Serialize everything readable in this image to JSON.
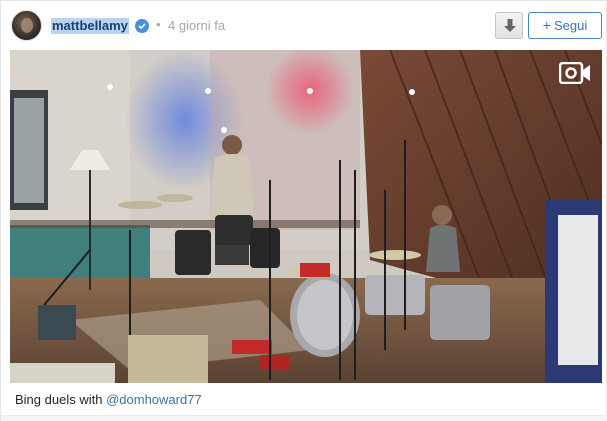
{
  "post": {
    "username": "mattbellamy",
    "separator": "•",
    "timestamp": "4 giorni fa",
    "follow_label": "Segui",
    "follow_plus": "+",
    "caption_text": "Bing duels with",
    "caption_mention": "@domhoward77"
  },
  "icons": {
    "verified": "verified-badge-icon",
    "download": "download-arrow-icon",
    "video": "video-camera-icon"
  },
  "colors": {
    "username_highlight": "#b9d3f2",
    "link": "#3f729b",
    "follow": "#3b74b7",
    "verified": "#4a90d9"
  }
}
